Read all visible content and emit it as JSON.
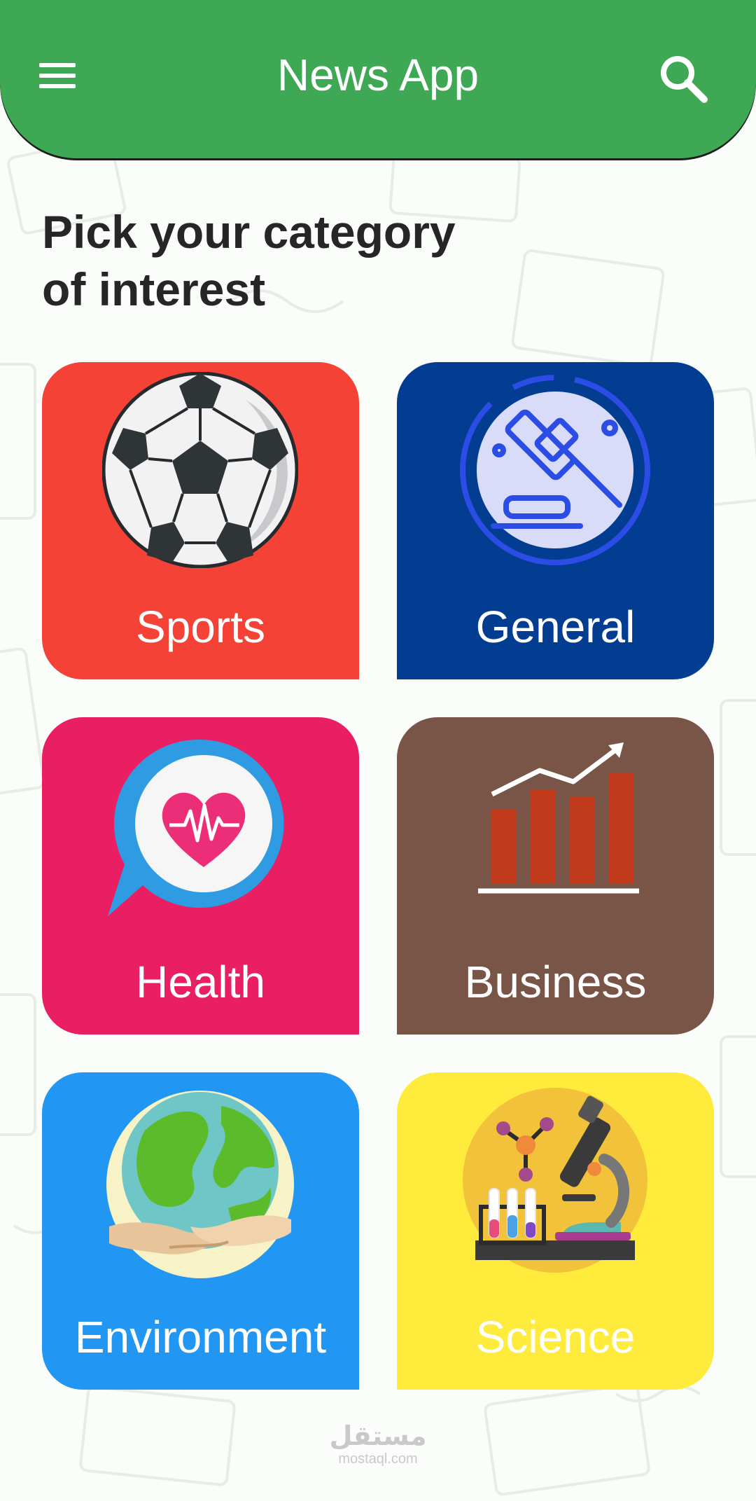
{
  "app_bar": {
    "title": "News App",
    "background_color": "#3ea854",
    "menu_icon": "hamburger-menu-icon",
    "search_icon": "search-icon"
  },
  "page": {
    "heading_line1": "Pick your category",
    "heading_line2": "of interest"
  },
  "categories": [
    {
      "label": "Sports",
      "color": "#f44336",
      "icon": "soccer-ball-icon"
    },
    {
      "label": "General",
      "color": "#023d92",
      "icon": "gavel-icon"
    },
    {
      "label": "Health",
      "color": "#e91e63",
      "icon": "heart-pulse-icon"
    },
    {
      "label": "Business",
      "color": "#795548",
      "icon": "bar-chart-growth-icon"
    },
    {
      "label": "Environment",
      "color": "#2196f3",
      "icon": "earth-in-hands-icon"
    },
    {
      "label": "Science",
      "color": "#ffeb3b",
      "icon": "microscope-lab-icon"
    }
  ],
  "watermark": {
    "arabic": "مستقل",
    "latin": "mostaql.com"
  }
}
